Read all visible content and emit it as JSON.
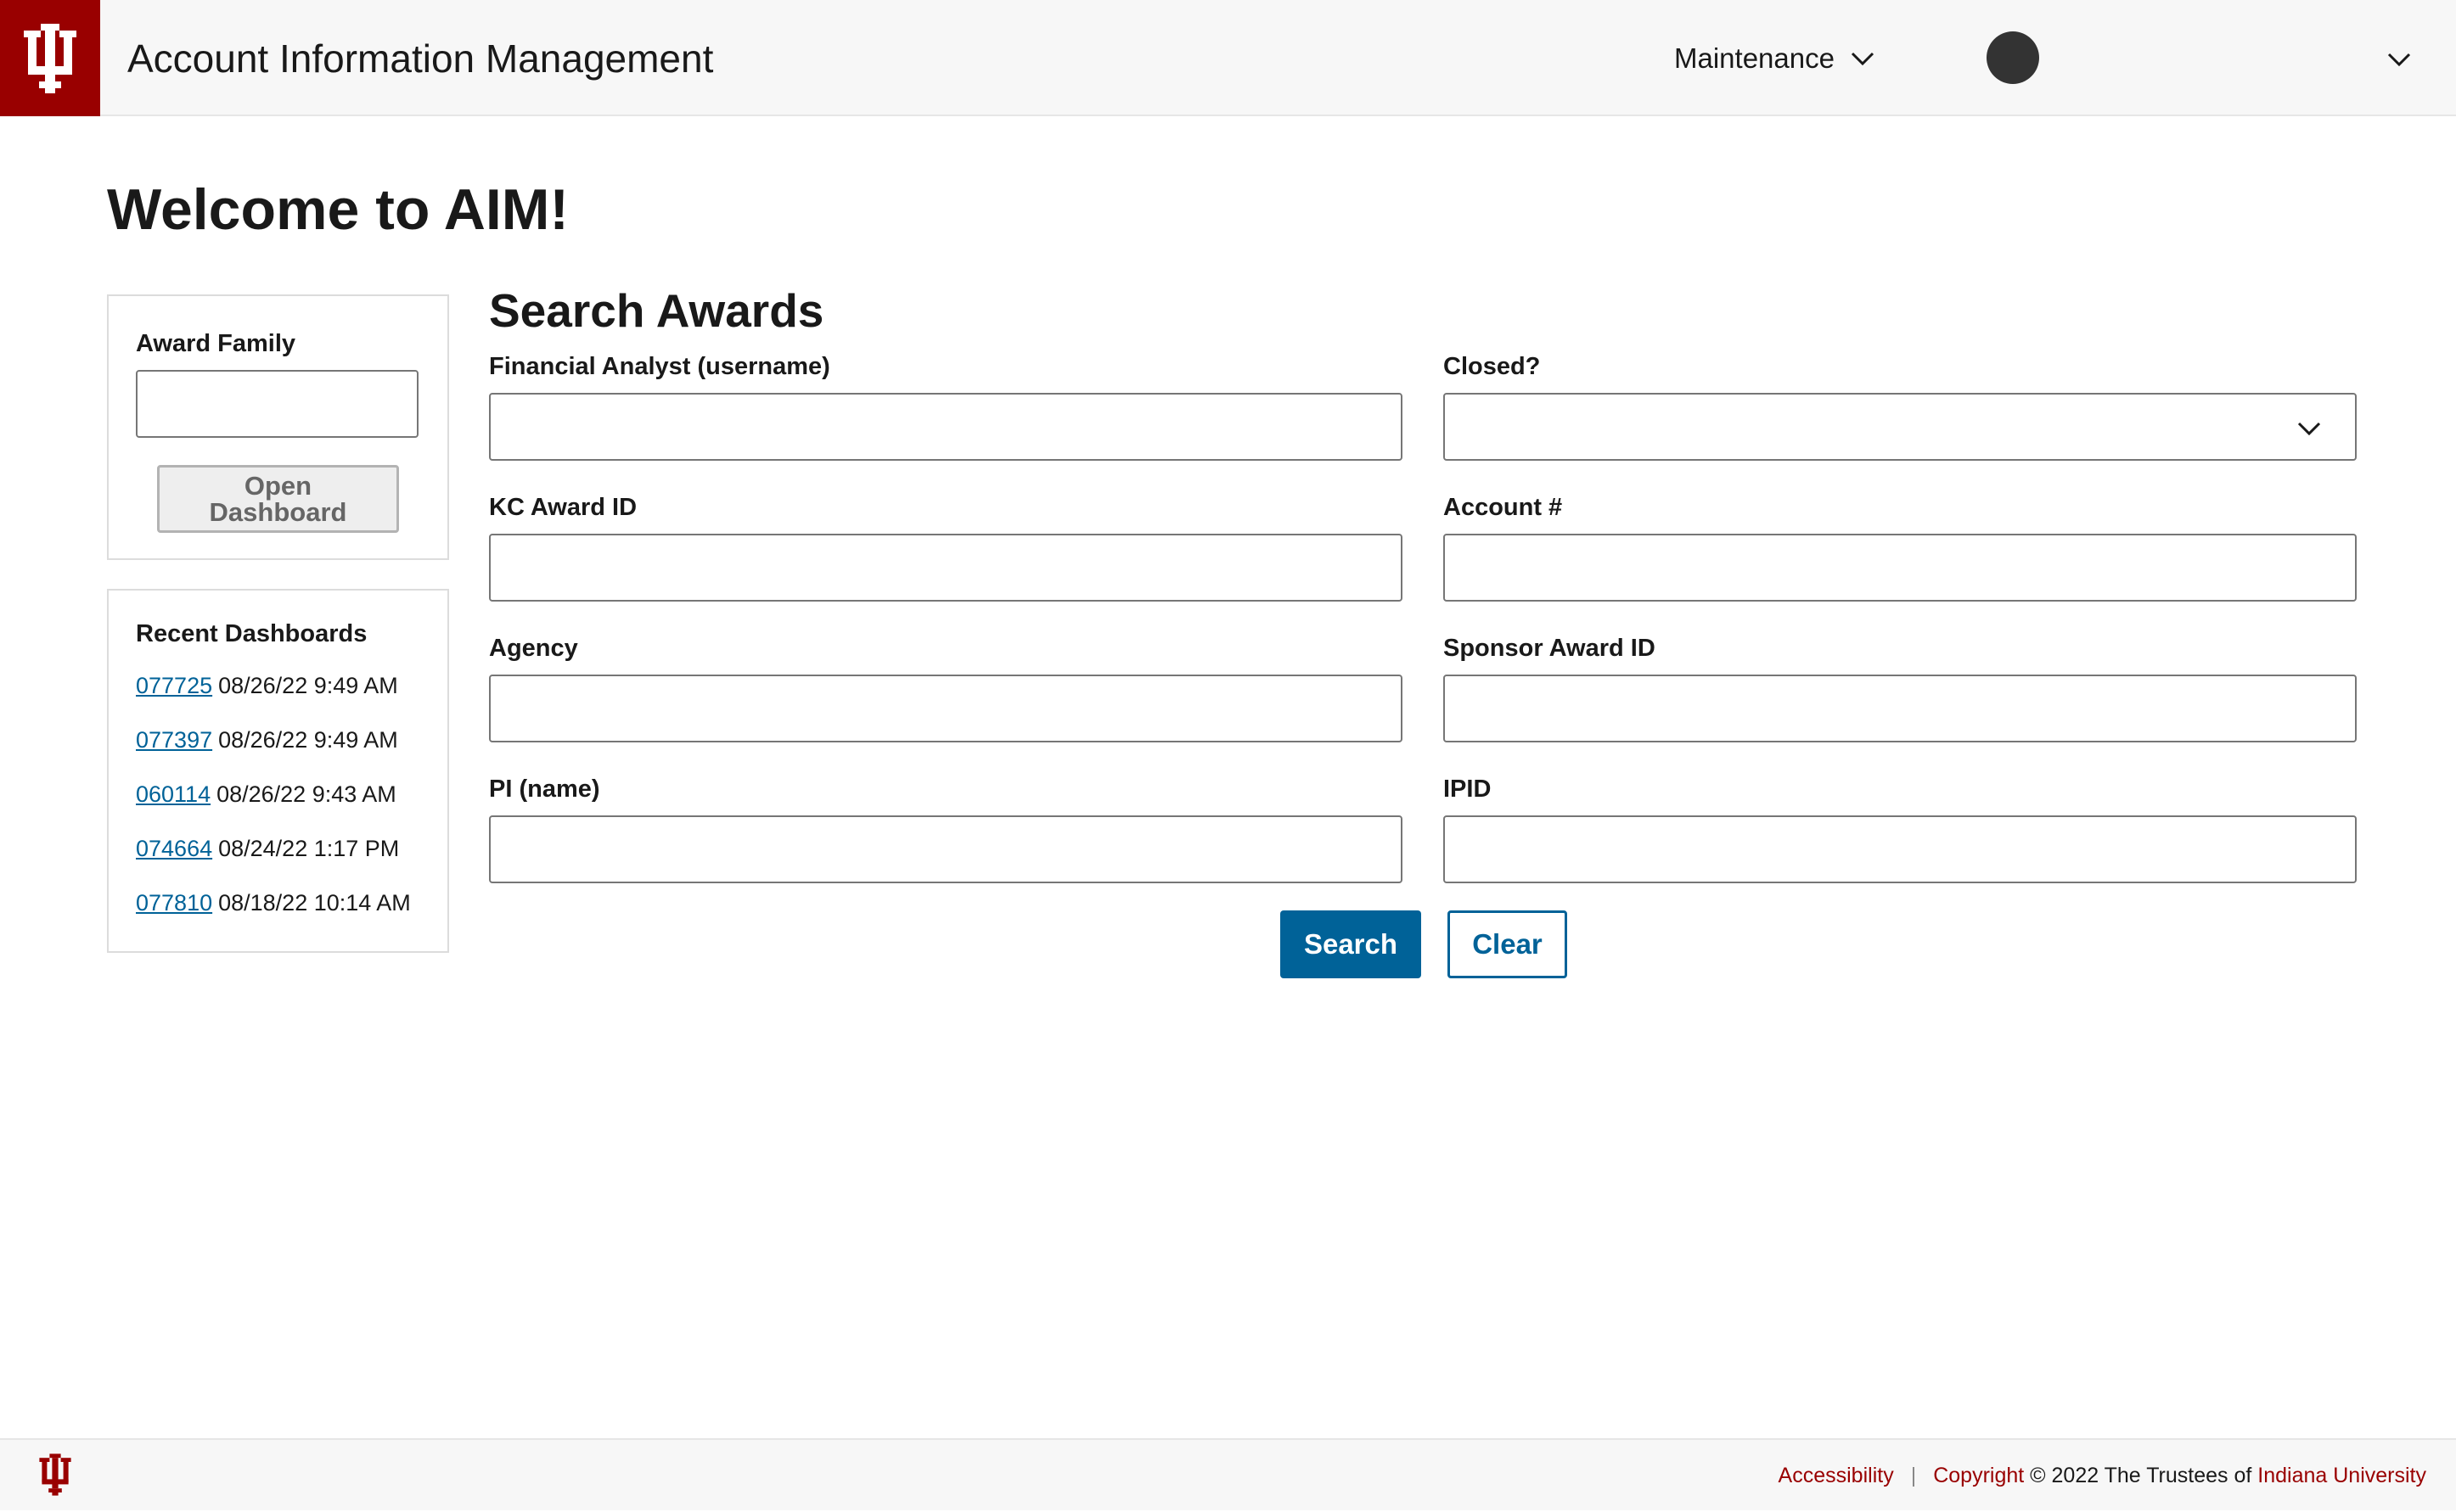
{
  "header": {
    "app_title": "Account Information Management",
    "maintenance_label": "Maintenance",
    "brand_color": "#990000",
    "logo_icon": "iu-trident-icon"
  },
  "main": {
    "welcome": "Welcome to AIM!",
    "award_family": {
      "label": "Award Family",
      "value": "",
      "open_button_line1": "Open",
      "open_button_line2": "Dashboard"
    },
    "recent": {
      "title": "Recent Dashboards",
      "items": [
        {
          "id": "077725",
          "time": "08/26/22 9:49 AM"
        },
        {
          "id": "077397",
          "time": "08/26/22 9:49 AM"
        },
        {
          "id": "060114",
          "time": "08/26/22 9:43 AM"
        },
        {
          "id": "074664",
          "time": "08/24/22 1:17 PM"
        },
        {
          "id": "077810",
          "time": "08/18/22 10:14 AM"
        }
      ]
    },
    "search": {
      "title": "Search Awards",
      "fields": {
        "financial_analyst": "Financial Analyst (username)",
        "closed": "Closed?",
        "kc_award_id": "KC Award ID",
        "account": "Account #",
        "agency": "Agency",
        "sponsor_award_id": "Sponsor Award ID",
        "pi_name": "PI (name)",
        "ipid": "IPID"
      },
      "search_button": "Search",
      "clear_button": "Clear",
      "accent_color": "#006298"
    }
  },
  "footer": {
    "accessibility": "Accessibility",
    "separator": "|",
    "copyright_link": "Copyright",
    "copyright_text": "© 2022 The Trustees of",
    "university": "Indiana University"
  }
}
